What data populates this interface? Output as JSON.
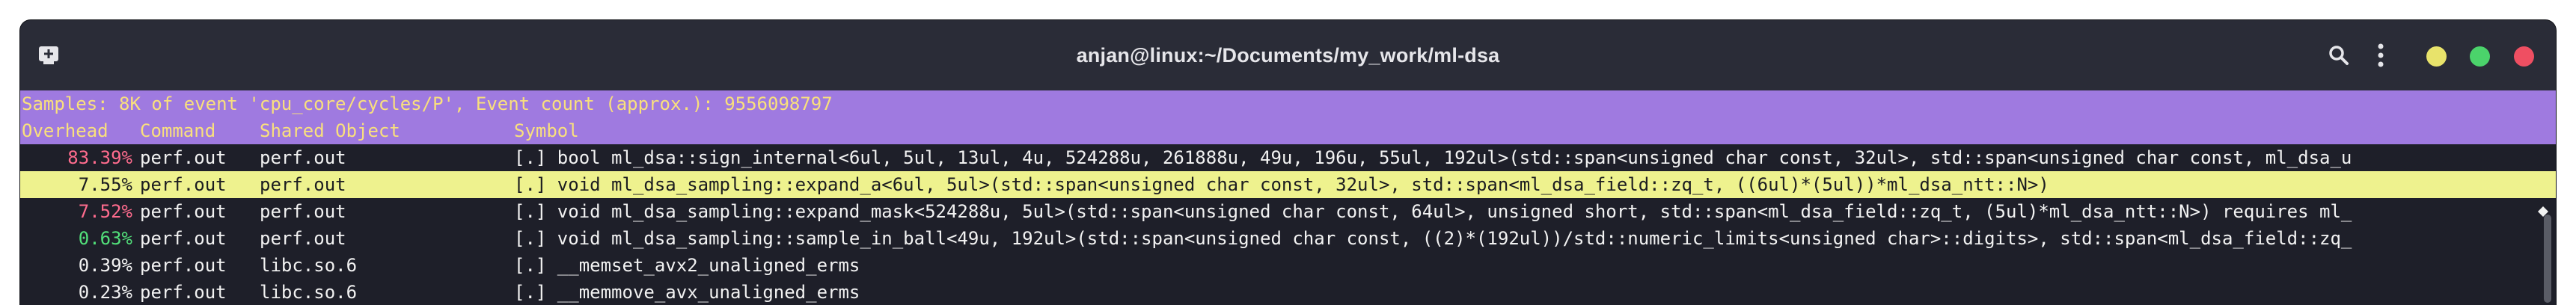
{
  "window": {
    "title": "anjan@linux:~/Documents/my_work/ml-dsa"
  },
  "icons": {
    "new_tab": "new-tab-icon",
    "search": "search-icon",
    "menu": "kebab-menu-icon"
  },
  "colors": {
    "yellow_dot": "#e8e36b",
    "green_dot": "#4bd36b",
    "red_dot": "#ef4f62",
    "header_bar": "#9f7ae0",
    "header_text": "#f9e07c",
    "selected_row": "#eef28e",
    "overhead_red": "#ff6c8e",
    "overhead_green": "#52e07a"
  },
  "perf": {
    "summary": "Samples: 8K of event 'cpu_core/cycles/P', Event count (approx.): 9556098797",
    "headers": {
      "overhead": "Overhead",
      "command": "Command",
      "shared_object": "Shared Object",
      "symbol": "Symbol"
    },
    "rows": [
      {
        "overhead": "83.39%",
        "command": "perf.out",
        "shared_object": "perf.out",
        "symbol": "[.] bool ml_dsa::sign_internal<6ul, 5ul, 13ul, 4u, 524288u, 261888u, 49u, 196u, 55ul, 192ul>(std::span<unsigned char const, 32ul>, std::span<unsigned char const, ml_dsa_u"
      },
      {
        "overhead": "7.55%",
        "command": "perf.out",
        "shared_object": "perf.out",
        "symbol": "[.] void ml_dsa_sampling::expand_a<6ul, 5ul>(std::span<unsigned char const, 32ul>, std::span<ml_dsa_field::zq_t, ((6ul)*(5ul))*ml_dsa_ntt::N>)"
      },
      {
        "overhead": "7.52%",
        "command": "perf.out",
        "shared_object": "perf.out",
        "symbol": "[.] void ml_dsa_sampling::expand_mask<524288u, 5ul>(std::span<unsigned char const, 64ul>, unsigned short, std::span<ml_dsa_field::zq_t, (5ul)*ml_dsa_ntt::N>) requires ml_"
      },
      {
        "overhead": "0.63%",
        "command": "perf.out",
        "shared_object": "perf.out",
        "symbol": "[.] void ml_dsa_sampling::sample_in_ball<49u, 192ul>(std::span<unsigned char const, ((2)*(192ul))/std::numeric_limits<unsigned char>::digits>, std::span<ml_dsa_field::zq_"
      },
      {
        "overhead": "0.39%",
        "command": "perf.out",
        "shared_object": "libc.so.6",
        "symbol": "[.] __memset_avx2_unaligned_erms"
      },
      {
        "overhead": "0.23%",
        "command": "perf.out",
        "shared_object": "libc.so.6",
        "symbol": "[.] __memmove_avx_unaligned_erms"
      }
    ]
  }
}
